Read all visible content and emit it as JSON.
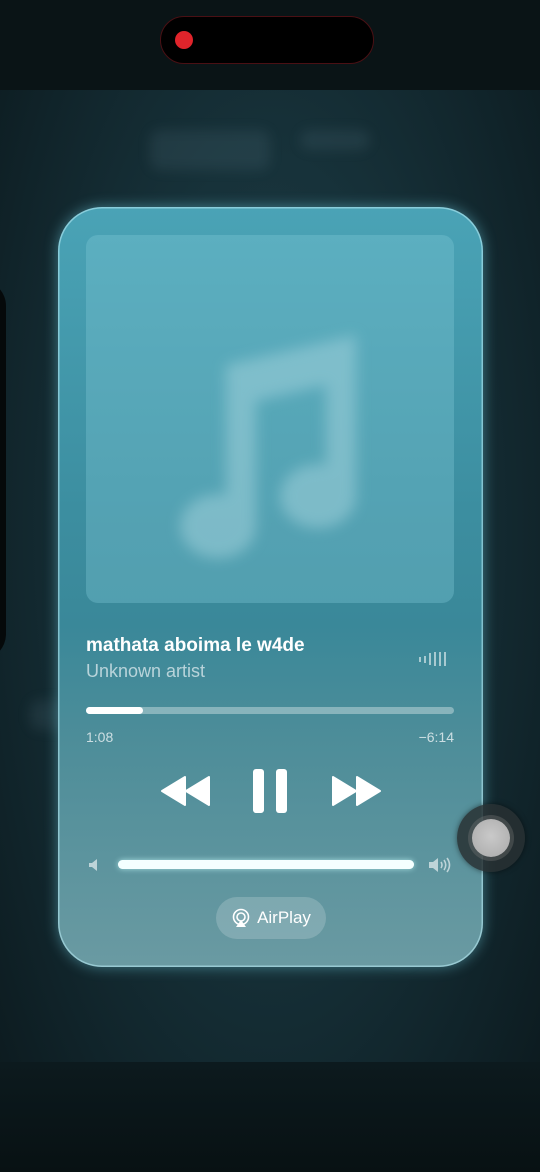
{
  "now_playing": {
    "song_title": "mathata aboima le w4de",
    "artist": "Unknown artist",
    "elapsed": "1:08",
    "remaining": "−6:14",
    "progress_fraction": 0.155,
    "volume_fraction": 1.0,
    "is_playing": true,
    "airplay_label": "AirPlay"
  },
  "icons": {
    "artwork": "music-note-icon",
    "waveform": "waveform-icon",
    "rewind": "rewind-icon",
    "pause": "pause-icon",
    "forward": "fast-forward-icon",
    "volume_low": "speaker-low-icon",
    "volume_high": "speaker-high-icon",
    "airplay": "airplay-icon"
  },
  "colors": {
    "recording_dot": "#e0242b",
    "card_accent": "#4aa3b6"
  }
}
